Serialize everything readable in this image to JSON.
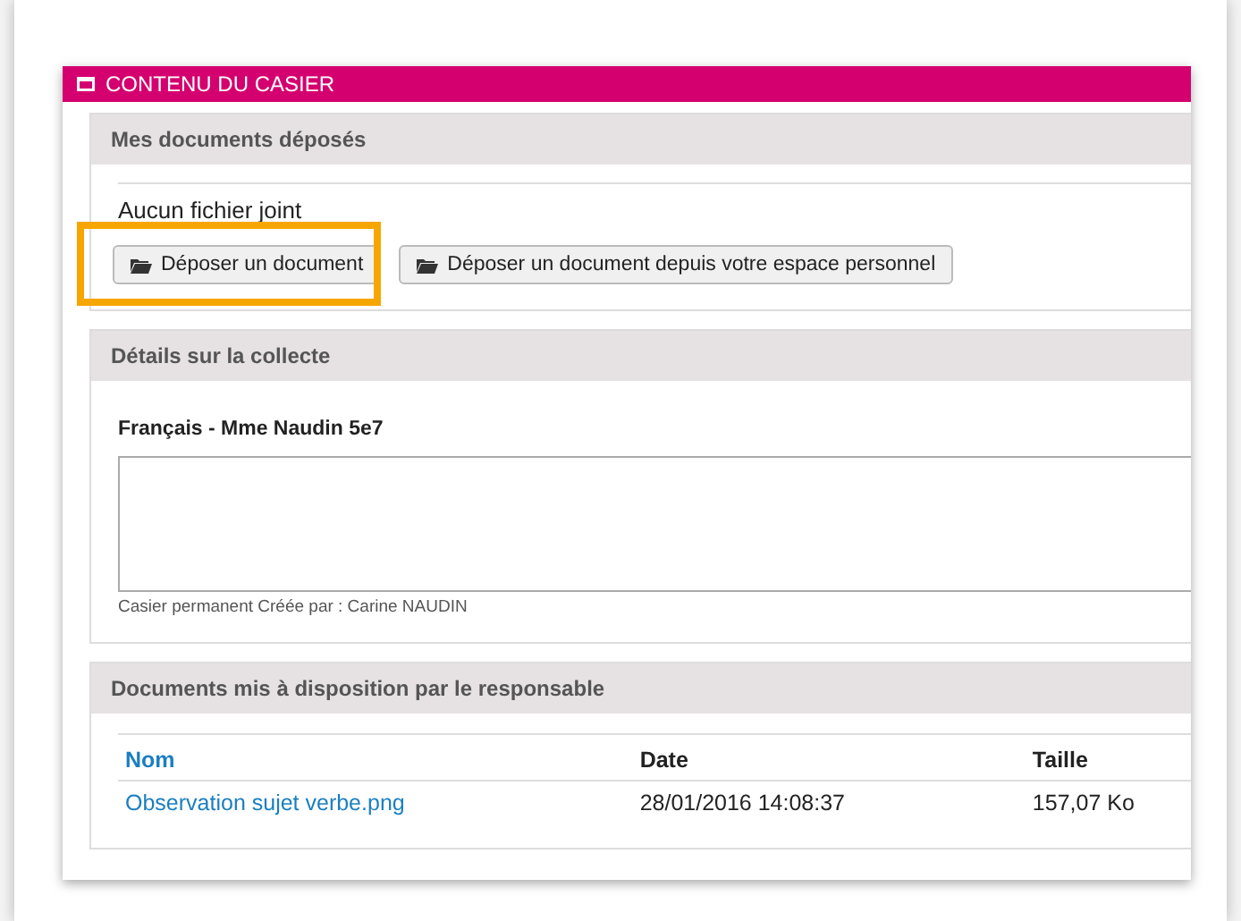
{
  "panel": {
    "title": "CONTENU DU CASIER"
  },
  "deposited": {
    "title": "Mes documents déposés",
    "empty_text": "Aucun fichier joint",
    "buttons": [
      {
        "label": "Déposer un document",
        "highlighted": true
      },
      {
        "label": "Déposer un document depuis votre espace personnel",
        "highlighted": false
      }
    ]
  },
  "details": {
    "title": "Détails sur la collecte",
    "subject": "Français - Mme Naudin 5e7",
    "footer": "Casier permanent  Créée par : Carine NAUDIN"
  },
  "shared": {
    "title": "Documents mis à disposition par le responsable",
    "columns": [
      "Nom",
      "Date",
      "Taille"
    ],
    "rows": [
      {
        "name": "Observation sujet verbe.png",
        "date": "28/01/2016 14:08:37",
        "size": "157,07 Ko"
      }
    ]
  }
}
